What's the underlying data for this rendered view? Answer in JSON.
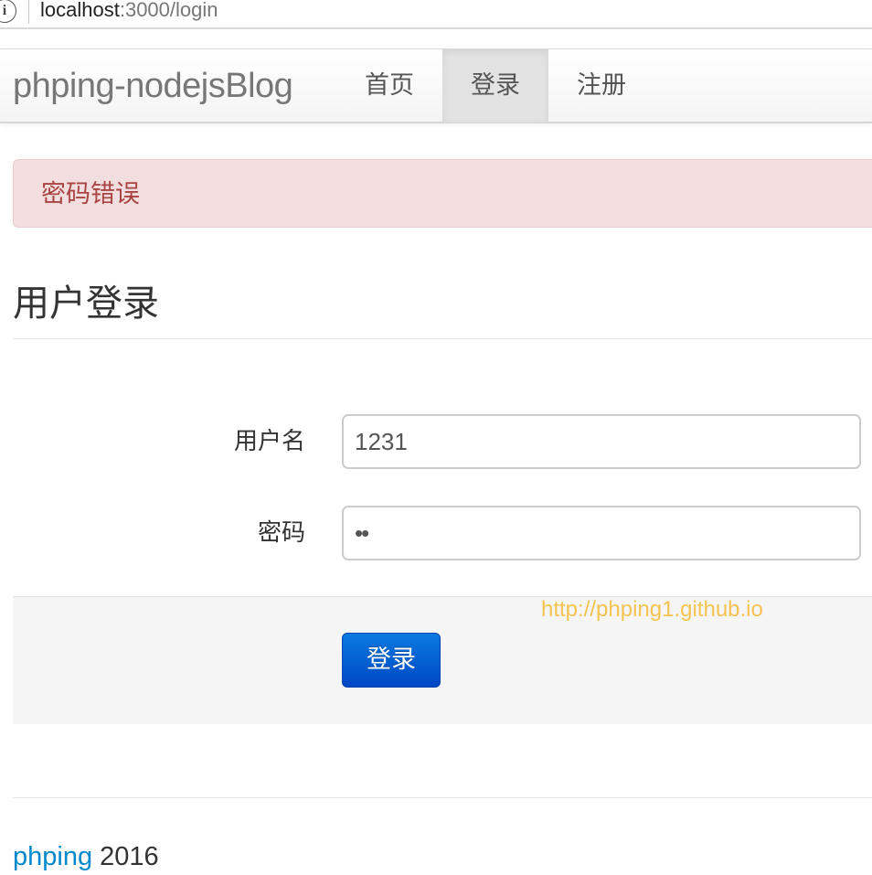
{
  "browser": {
    "url_host": "localhost",
    "url_path": ":3000/login",
    "info_icon": "info-icon"
  },
  "navbar": {
    "brand": "phping-nodejsBlog",
    "items": [
      {
        "label": "首页",
        "active": false
      },
      {
        "label": "登录",
        "active": true
      },
      {
        "label": "注册",
        "active": false
      }
    ]
  },
  "alert": {
    "message": "密码错误",
    "color": "#a94442",
    "background": "#f2dede"
  },
  "page": {
    "title": "用户登录"
  },
  "form": {
    "username_label": "用户名",
    "username_value": "1231",
    "password_label": "密码",
    "password_value": "••",
    "submit_label": "登录"
  },
  "watermark": "http://phping1.github.io",
  "footer": {
    "author": "phping",
    "year": "2016"
  },
  "colors": {
    "primary_button": "#0a6fd8",
    "link": "#0088cc",
    "watermark": "#f5c351"
  }
}
